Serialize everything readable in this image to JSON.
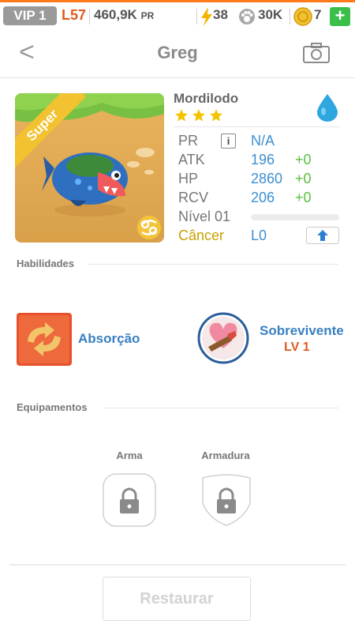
{
  "topbar": {
    "vip": "VIP 1",
    "level": "L57",
    "power": "460,9K",
    "power_suffix": "PR",
    "energy": "38",
    "paws": "30K",
    "coins": "7",
    "plus": "+"
  },
  "header": {
    "back": "<",
    "title": "Greg"
  },
  "monster": {
    "name": "Mordilodo",
    "rarity_badge": "Super",
    "stars": 3,
    "element": "water-drop",
    "sign_icon": "cancer-icon"
  },
  "stats": {
    "pr": {
      "label": "PR",
      "info": "i",
      "value": "N/A"
    },
    "atk": {
      "label": "ATK",
      "value": "196",
      "bonus": "+0"
    },
    "hp": {
      "label": "HP",
      "value": "2860",
      "bonus": "+0"
    },
    "rcv": {
      "label": "RCV",
      "value": "206",
      "bonus": "+0"
    },
    "level": {
      "label": "Nível 01",
      "progress": 0
    },
    "sign": {
      "label": "Câncer",
      "value": "L0"
    }
  },
  "skills": {
    "title": "Habilidades",
    "items": [
      {
        "name": "Absorção"
      },
      {
        "name": "Sobrevivente",
        "level": "LV 1"
      }
    ]
  },
  "equipment": {
    "title": "Equipamentos",
    "weapon": "Arma",
    "armor": "Armadura"
  },
  "actions": {
    "restore": "Restaurar"
  },
  "colors": {
    "accent_orange": "#e05a1f",
    "stat_blue": "#3d8fd1",
    "bonus_green": "#5bbf3c",
    "cancer_yellow": "#c9a000"
  }
}
